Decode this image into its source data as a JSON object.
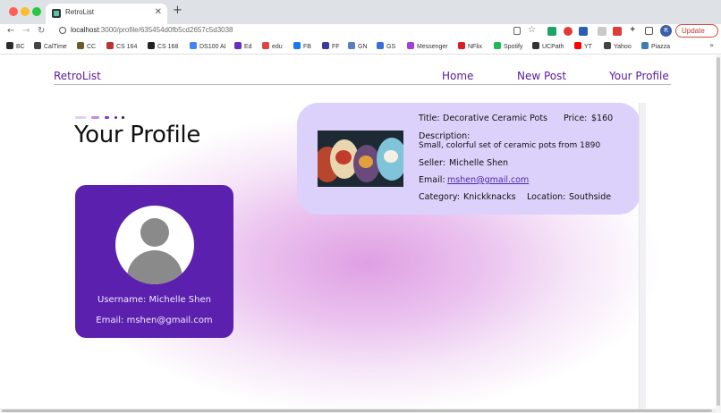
{
  "browser": {
    "tab_title": "RetroList",
    "tab_close": "✕",
    "new_tab": "+",
    "url_host": "localhost",
    "url_path": ":3000/profile/635454d0fb5cd2657c5d3038",
    "update_label": "Update",
    "profile_initial": "R",
    "bookmarks": [
      {
        "label": "BC",
        "icon": "bc-icon",
        "color": "#2b2b2b"
      },
      {
        "label": "CalTime",
        "icon": "caltime-icon",
        "color": "#444"
      },
      {
        "label": "CC",
        "icon": "cc-icon",
        "color": "#6b5a2a"
      },
      {
        "label": "CS 164",
        "icon": "cs164-icon",
        "color": "#b33"
      },
      {
        "label": "CS 168",
        "icon": "cs168-icon",
        "color": "#222"
      },
      {
        "label": "DS100 AI",
        "icon": "google-icon",
        "color": "#4285f4"
      },
      {
        "label": "Ed",
        "icon": "ed-icon",
        "color": "#6a2cbf"
      },
      {
        "label": "edu",
        "icon": "gmail-icon",
        "color": "#d44"
      },
      {
        "label": "FB",
        "icon": "facebook-icon",
        "color": "#1877f2"
      },
      {
        "label": "FF",
        "icon": "ff-icon",
        "color": "#3a3a9a"
      },
      {
        "label": "GN",
        "icon": "gn-icon",
        "color": "#5a7fb8"
      },
      {
        "label": "GS",
        "icon": "gs-icon",
        "color": "#3a6fd8"
      },
      {
        "label": "Messenger",
        "icon": "messenger-icon",
        "color": "#a33de0"
      },
      {
        "label": "NFlix",
        "icon": "netflix-icon",
        "color": "#d81f26"
      },
      {
        "label": "Spotify",
        "icon": "spotify-icon",
        "color": "#1db954"
      },
      {
        "label": "UCPath",
        "icon": "ucpath-icon",
        "color": "#333"
      },
      {
        "label": "YT",
        "icon": "youtube-icon",
        "color": "#ff0000"
      },
      {
        "label": "Yahoo",
        "icon": "yahoo-icon",
        "color": "#444"
      },
      {
        "label": "Piazza",
        "icon": "piazza-icon",
        "color": "#3e7cb1"
      }
    ],
    "bookmarks_more": "»"
  },
  "site": {
    "brand": "RetroList",
    "nav": {
      "home": "Home",
      "new_post": "New Post",
      "profile": "Your Profile"
    },
    "accent_color": "#5b21ae"
  },
  "page": {
    "title": "Your Profile"
  },
  "profile": {
    "username_line": "Username: Michelle Shen",
    "email_line": "Email: mshen@gmail.com"
  },
  "post": {
    "title_label": "Title:",
    "title_value": "Decorative Ceramic Pots",
    "price_label": "Price:",
    "price_value": "$160",
    "description_label": "Description:",
    "description_value": "Small, colorful set of ceramic pots from 1890",
    "seller_label": "Seller:",
    "seller_value": "Michelle Shen",
    "email_label": "Email:",
    "email_value": "mshen@gmail.com",
    "category_label": "Category:",
    "category_value": "Knickknacks",
    "location_label": "Location:",
    "location_value": "Southside"
  }
}
